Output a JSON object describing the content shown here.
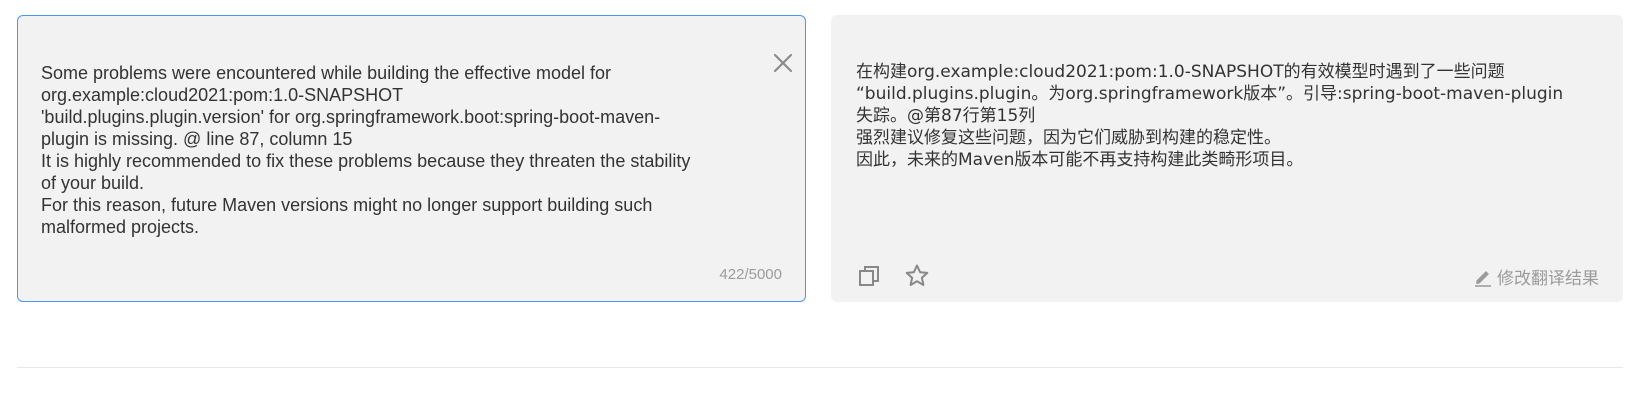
{
  "source": {
    "text": "Some problems were encountered while building the effective model for\norg.example:cloud2021:pom:1.0-SNAPSHOT\n'build.plugins.plugin.version' for org.springframework.boot:spring-boot-maven-\nplugin is missing. @ line 87, column 15\nIt is highly recommended to fix these problems because they threaten the stability\nof your build.\nFor this reason, future Maven versions might no longer support building such\nmalformed projects.",
    "char_count": "422/5000",
    "close_icon": "close-icon"
  },
  "target": {
    "text": "在构建org.example:cloud2021:pom:1.0-SNAPSHOT的有效模型时遇到了一些问题\n“build.plugins.plugin。为org.springframework版本”。引导:spring-boot-maven-plugin\n失踪。@第87行第15列\n强烈建议修复这些问题，因为它们威胁到构建的稳定性。\n因此，未来的Maven版本可能不再支持构建此类畸形项目。",
    "copy_icon": "copy-icon",
    "star_icon": "star-icon",
    "edit_icon": "pencil-icon",
    "edit_label": "修改翻译结果"
  },
  "colors": {
    "panel_bg": "#f2f2f2",
    "source_border": "#4c95f4",
    "muted_text": "#9b9b9b",
    "icon": "#888888"
  }
}
